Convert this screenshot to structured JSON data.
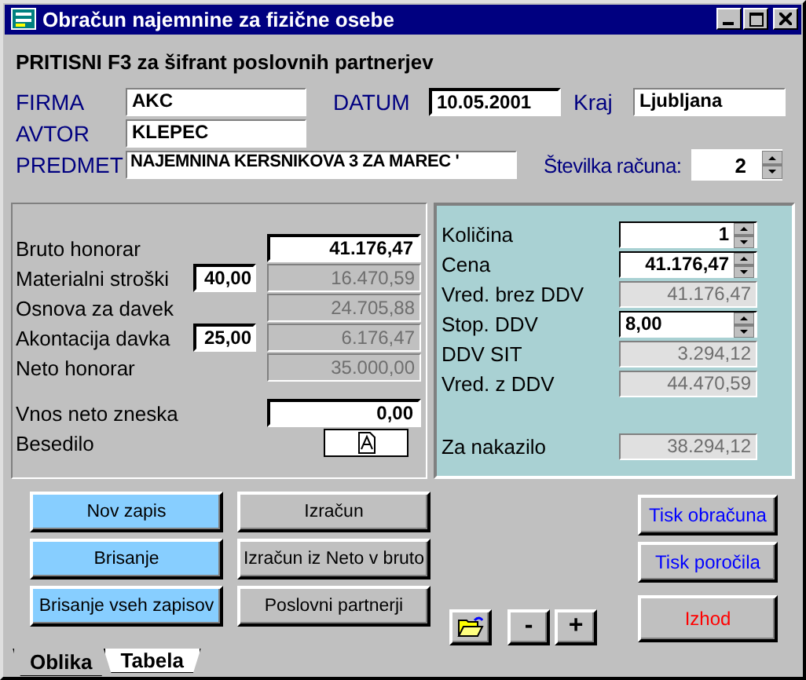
{
  "window": {
    "title": "Obračun najemnine za fizične osebe"
  },
  "hint": "PRITISNI F3 za šifrant poslovnih partnerjev",
  "header": {
    "firma": {
      "label": "FIRMA",
      "value": "AKC"
    },
    "datum": {
      "label": "DATUM",
      "value": "10.05.2001"
    },
    "kraj": {
      "label": "Kraj",
      "value": "Ljubljana"
    },
    "avtor": {
      "label": "AVTOR",
      "value": "KLEPEC"
    },
    "predmet": {
      "label": "PREDMET",
      "value": "NAJEMNINA KERSNIKOVA 3  ZA MAREC '"
    },
    "stevilka": {
      "label": "Številka računa:",
      "value": "2"
    }
  },
  "calculation": [
    {
      "label": "Bruto honorar",
      "value": "41.176,47",
      "disabled": false
    },
    {
      "label": "Materialni stroški",
      "percent": "40,00",
      "value": "16.470,59",
      "disabled": true
    },
    {
      "label": "Osnova za davek",
      "value": "24.705,88",
      "disabled": true
    },
    {
      "label": "Akontacija davka",
      "percent": "25,00",
      "value": "6.176,47",
      "disabled": true
    },
    {
      "label": "Neto honorar",
      "value": "35.000,00",
      "disabled": true
    }
  ],
  "entry": [
    {
      "kind": "field",
      "label": "Vnos neto zneska",
      "value": "0,00",
      "disabled": false
    },
    {
      "kind": "icon-button",
      "label": "Besedilo"
    }
  ],
  "vat": [
    {
      "kind": "amount",
      "label": "Količina",
      "value": "1",
      "disabled": false,
      "spinner": true
    },
    {
      "kind": "amount",
      "label": "Cena",
      "value": "41.176,47",
      "disabled": false,
      "spinner": true
    },
    {
      "kind": "amount",
      "label": "Vred. brez DDV",
      "value": "41.176,47",
      "disabled": true,
      "spinner": false
    },
    {
      "kind": "rate",
      "label": "Stop. DDV",
      "value": "8,00",
      "disabled": false,
      "spinner": true
    },
    {
      "kind": "amount",
      "label": "DDV SIT",
      "value": "3.294,12",
      "disabled": true,
      "spinner": false
    },
    {
      "kind": "amount",
      "label": "Vred. z DDV",
      "value": "44.470,59",
      "disabled": true,
      "spinner": false
    }
  ],
  "payout": {
    "label": "Za nakazilo",
    "value": "38.294,12",
    "disabled": true
  },
  "record_buttons": [
    {
      "label": "Nov zapis",
      "highlight": true
    },
    {
      "label": "Brisanje",
      "highlight": true
    },
    {
      "label": "Brisanje vseh zapisov",
      "highlight": true
    }
  ],
  "action_buttons": [
    {
      "label": "Izračun",
      "highlight": false
    },
    {
      "label": "Izračun iz  Neto v bruto",
      "highlight": false
    },
    {
      "label": "Poslovni partnerji",
      "highlight": false
    }
  ],
  "nav_buttons": [
    {
      "kind": "open"
    },
    {
      "kind": "text",
      "label": "-"
    },
    {
      "kind": "text",
      "label": "+"
    }
  ],
  "print_buttons": [
    {
      "label": "Tisk obračuna",
      "color": "#0000ff"
    },
    {
      "label": "Tisk poročila",
      "color": "#0000ff"
    },
    {
      "label": "Izhod",
      "color": "#ff0000"
    }
  ],
  "tabs": [
    {
      "label": "Oblika",
      "selected": true
    },
    {
      "label": "Tabela",
      "selected": false
    }
  ]
}
